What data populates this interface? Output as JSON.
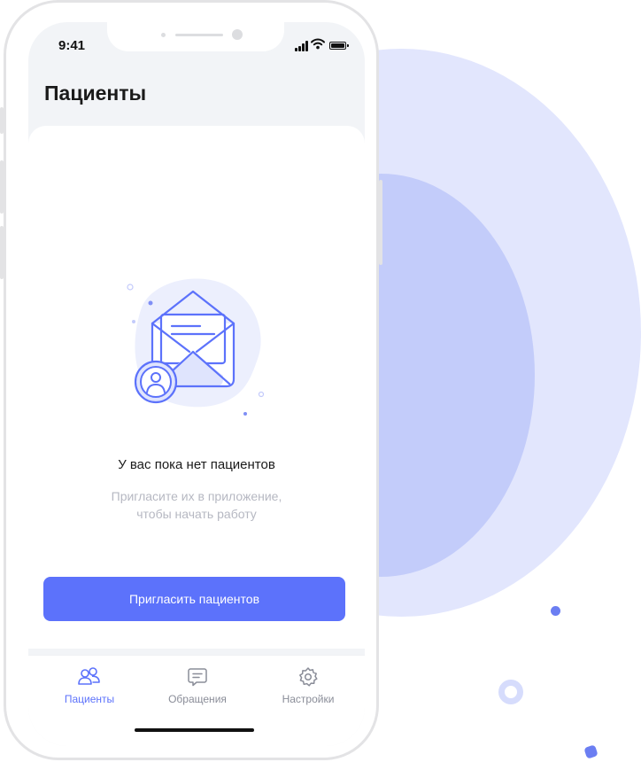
{
  "status_bar": {
    "time": "9:41"
  },
  "header": {
    "title": "Пациенты"
  },
  "empty_state": {
    "title": "У вас пока нет пациентов",
    "subtitle_line1": "Пригласите их в приложение,",
    "subtitle_line2": "чтобы начать работу"
  },
  "primary_action": {
    "label": "Пригласить пациентов"
  },
  "tabs": [
    {
      "label": "Пациенты",
      "icon": "users-icon",
      "active": true
    },
    {
      "label": "Обращения",
      "icon": "message-icon",
      "active": false
    },
    {
      "label": "Настройки",
      "icon": "gear-icon",
      "active": false
    }
  ],
  "colors": {
    "accent": "#5c72fb",
    "tab_inactive": "#8a8d98",
    "muted_text": "#b6b8c2",
    "decor_light": "#e2e6fd",
    "decor_mid": "#c3ccfa"
  }
}
